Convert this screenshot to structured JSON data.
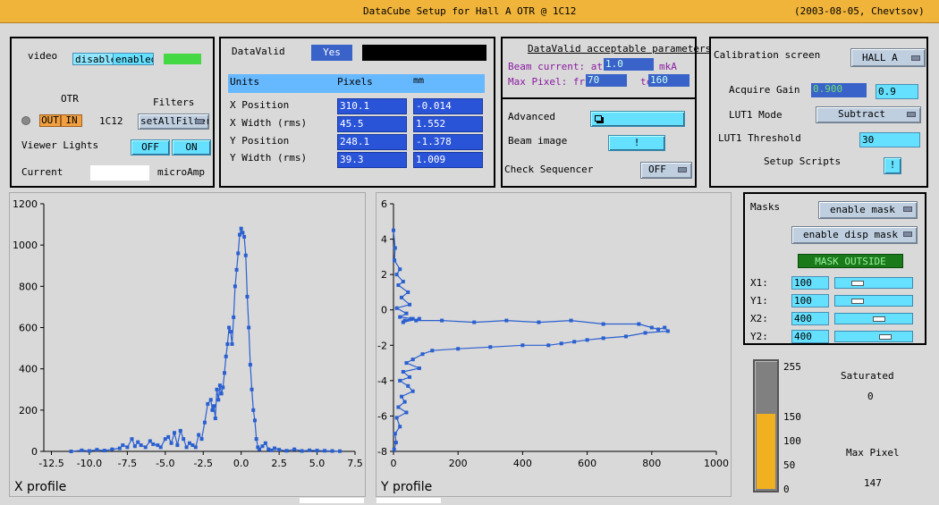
{
  "title": {
    "main": "DataCube  Setup  for  Hall A OTR @ 1C12",
    "info": "(2003-08-05, Chevtsov)"
  },
  "camera": {
    "video_label": "video",
    "video_disabled": "disabled",
    "video_enabled": "enabled",
    "otr_label": "OTR",
    "otr_out": "OUT",
    "otr_in": "IN",
    "location": "1C12",
    "filters_label": "Filters",
    "filters_value": "setAllFilters",
    "viewer_lights_label": "Viewer Lights",
    "lights_off": "OFF",
    "lights_on": "ON",
    "current_label": "Current",
    "current_value": "",
    "current_unit": "microAmp"
  },
  "datavalid": {
    "label": "DataValid",
    "value": "Yes",
    "headers": [
      "Units",
      "Pixels",
      "mm"
    ],
    "rows": [
      {
        "name": "X Position",
        "pixels": "310.1",
        "mm": "-0.014"
      },
      {
        "name": "X Width (rms)",
        "pixels": "45.5",
        "mm": "1.552"
      },
      {
        "name": "Y Position",
        "pixels": "248.1",
        "mm": "-1.378"
      },
      {
        "name": "Y Width (rms)",
        "pixels": "39.3",
        "mm": "1.009"
      }
    ]
  },
  "params": {
    "title": "DataValid acceptable parameters",
    "beam_current_label": "Beam current: at l",
    "beam_current_value": "1.0",
    "beam_current_unit": "mkA",
    "max_pixel_label": "Max Pixel:  frc",
    "max_pixel_from": "70",
    "max_pixel_to_label": "tc",
    "max_pixel_to": "160"
  },
  "advanced": {
    "advanced_label": "Advanced",
    "advanced_icon": "window-icon",
    "beam_image_label": "Beam image",
    "beam_image_btn": "!",
    "check_sequencer_label": "Check Sequencer",
    "check_sequencer_value": "OFF"
  },
  "calibration": {
    "screen_label": "Calibration screen",
    "screen_value": "HALL A",
    "acquire_gain_label": "Acquire Gain",
    "acquire_gain_readback": "0.900",
    "acquire_gain_set": "0.9",
    "lut1_mode_label": "LUT1 Mode",
    "lut1_mode_value": "Subtract",
    "lut1_threshold_label": "LUT1 Threshold",
    "lut1_threshold_value": "30",
    "setup_scripts_label": "Setup Scripts",
    "setup_scripts_btn": "!"
  },
  "masks": {
    "label": "Masks",
    "enable_mask": "enable mask",
    "enable_disp_mask": "enable disp mask",
    "mask_outside": "MASK OUTSIDE",
    "rows": [
      {
        "name": "X1:",
        "value": "100",
        "slider": 0.25
      },
      {
        "name": "Y1:",
        "value": "100",
        "slider": 0.25
      },
      {
        "name": "X2:",
        "value": "400",
        "slider": 0.6
      },
      {
        "name": "Y2:",
        "value": "400",
        "slider": 0.7
      }
    ]
  },
  "meter": {
    "ticks": [
      "255",
      "150",
      "100",
      "50",
      "0"
    ],
    "level": 147,
    "max": 255,
    "saturated_label": "Saturated",
    "saturated_value": "0",
    "max_pixel_label": "Max Pixel",
    "max_pixel_value": "147",
    "colors": {
      "fill": "#f0b020",
      "empty": "#808080"
    }
  },
  "chart_data": [
    {
      "type": "line",
      "title": "",
      "xlabel": "X profile",
      "ylabel": "",
      "xlim": [
        -13,
        7.5
      ],
      "ylim": [
        0,
        1200
      ],
      "xticks": [
        "-12.5",
        "-10.0",
        "-7.5",
        "-5.0",
        "-2.5",
        "0.0",
        "2.5",
        "5.0",
        "7.5"
      ],
      "yticks": [
        "0",
        "200",
        "400",
        "600",
        "800",
        "1000",
        "1200"
      ],
      "color": "#2a5fd0",
      "series": [
        {
          "x": [
            -11.2,
            -10.5,
            -10,
            -9.5,
            -9,
            -8.5,
            -8,
            -7.8,
            -7.5,
            -7.2,
            -7,
            -6.8,
            -6.6,
            -6.3,
            -6,
            -5.8,
            -5.5,
            -5.3,
            -5,
            -4.8,
            -4.6,
            -4.4,
            -4.2,
            -4,
            -3.8,
            -3.6,
            -3.4,
            -3.2,
            -3,
            -2.8,
            -2.6,
            -2.4,
            -2.2,
            -2,
            -1.9,
            -1.8,
            -1.7,
            -1.6,
            -1.5,
            -1.4,
            -1.3,
            -1.2,
            -1.1,
            -1,
            -0.9,
            -0.8,
            -0.7,
            -0.6,
            -0.5,
            -0.4,
            -0.3,
            -0.2,
            -0.1,
            0,
            0.1,
            0.2,
            0.3,
            0.4,
            0.5,
            0.6,
            0.7,
            0.8,
            0.9,
            1.0,
            1.1,
            1.2,
            1.4,
            1.6,
            1.8,
            2.0,
            2.2,
            2.5,
            3,
            3.5,
            4,
            4.5,
            5,
            5.5,
            6,
            6.5
          ],
          "y": [
            0,
            5,
            2,
            8,
            4,
            10,
            15,
            30,
            20,
            60,
            25,
            45,
            30,
            20,
            50,
            35,
            30,
            20,
            60,
            70,
            40,
            90,
            30,
            100,
            60,
            20,
            40,
            30,
            20,
            80,
            60,
            140,
            230,
            250,
            200,
            220,
            160,
            300,
            250,
            320,
            280,
            310,
            380,
            460,
            520,
            600,
            580,
            520,
            650,
            800,
            880,
            960,
            1050,
            1080,
            1060,
            1040,
            950,
            750,
            600,
            420,
            300,
            200,
            150,
            60,
            20,
            10,
            25,
            40,
            10,
            5,
            15,
            8,
            3,
            10,
            2,
            5,
            4,
            3,
            2,
            1
          ]
        }
      ]
    },
    {
      "type": "line",
      "title": "",
      "xlabel": "Y profile",
      "ylabel": "",
      "xlim": [
        0,
        1000
      ],
      "ylim": [
        -8,
        6
      ],
      "xticks": [
        "0",
        "200",
        "400",
        "600",
        "800",
        "1000"
      ],
      "yticks": [
        "6",
        "4",
        "2",
        "0",
        "-2",
        "-4",
        "-6",
        "-8"
      ],
      "color": "#2a5fd0",
      "series": [
        {
          "x": [
            0,
            5,
            3,
            20,
            10,
            30,
            15,
            45,
            25,
            50,
            10,
            40,
            20,
            60,
            35,
            55,
            30,
            80,
            70,
            150,
            250,
            350,
            450,
            550,
            650,
            760,
            800,
            820,
            840,
            850,
            780,
            720,
            650,
            600,
            560,
            520,
            480,
            400,
            300,
            200,
            120,
            90,
            60,
            40,
            80,
            30,
            50,
            20,
            45,
            60,
            25,
            35,
            15,
            40,
            10,
            20,
            5,
            8,
            2
          ],
          "y": [
            4.5,
            3.5,
            2.8,
            2.3,
            2.0,
            1.6,
            1.4,
            1.0,
            0.7,
            0.3,
            0.1,
            -0.2,
            -0.4,
            -0.5,
            -0.6,
            -0.5,
            -0.7,
            -0.5,
            -0.6,
            -0.6,
            -0.7,
            -0.6,
            -0.7,
            -0.6,
            -0.8,
            -0.8,
            -1.0,
            -1.1,
            -1.0,
            -1.2,
            -1.3,
            -1.5,
            -1.6,
            -1.7,
            -1.8,
            -1.9,
            -2.0,
            -2.0,
            -2.1,
            -2.2,
            -2.3,
            -2.5,
            -2.8,
            -3.0,
            -3.3,
            -3.5,
            -3.8,
            -4.0,
            -4.3,
            -4.6,
            -4.9,
            -5.2,
            -5.5,
            -5.8,
            -6.1,
            -6.6,
            -7.0,
            -7.5,
            -7.9
          ]
        }
      ]
    }
  ]
}
